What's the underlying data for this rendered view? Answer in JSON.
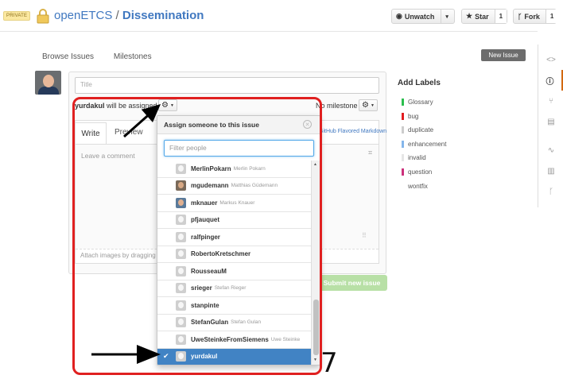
{
  "header": {
    "private_badge": "PRIVATE",
    "owner": "openETCS",
    "separator": "/",
    "repo": "Dissemination",
    "watch": {
      "label": "Unwatch",
      "caret": "▾"
    },
    "star": {
      "label": "Star",
      "count": "1"
    },
    "fork": {
      "label": "Fork",
      "count": "1"
    }
  },
  "nav": {
    "browse_issues": "Browse Issues",
    "milestones": "Milestones",
    "new_issue": "New Issue"
  },
  "form": {
    "title_placeholder": "Title",
    "assignee_name": "yurdakul",
    "assignee_suffix": " will be assigned",
    "milestone": "No milestone",
    "tab_write": "Write",
    "tab_preview": "Preview",
    "gfm": "GitHub Flavored Markdown",
    "comment_placeholder": "Leave a comment",
    "attach": "Attach images by dragging",
    "submit": "Submit new issue"
  },
  "labels": {
    "title": "Add Labels",
    "items": [
      {
        "name": "Glossary",
        "color": "#2cbe4e"
      },
      {
        "name": "bug",
        "color": "#e11d21"
      },
      {
        "name": "duplicate",
        "color": "#cccccc"
      },
      {
        "name": "enhancement",
        "color": "#84b6eb"
      },
      {
        "name": "invalid",
        "color": "#e6e6e6"
      },
      {
        "name": "question",
        "color": "#cc317c"
      },
      {
        "name": "wontfix",
        "color": "#ffffff"
      }
    ]
  },
  "dropdown": {
    "title": "Assign someone to this issue",
    "filter_placeholder": "Filter people",
    "people": [
      {
        "login": "MerlinPokarn",
        "name": "Merlin Pokarn",
        "avatar": "default"
      },
      {
        "login": "mgudemann",
        "name": "Matthias Güdemann",
        "avatar": "photo"
      },
      {
        "login": "mknauer",
        "name": "Markus Knauer",
        "avatar": "photo2"
      },
      {
        "login": "pfjauquet",
        "name": "",
        "avatar": "default"
      },
      {
        "login": "ralfpinger",
        "name": "",
        "avatar": "default"
      },
      {
        "login": "RobertoKretschmer",
        "name": "",
        "avatar": "default"
      },
      {
        "login": "RousseauM",
        "name": "",
        "avatar": "default"
      },
      {
        "login": "srieger",
        "name": "Stefan Rieger",
        "avatar": "default"
      },
      {
        "login": "stanpinte",
        "name": "",
        "avatar": "default"
      },
      {
        "login": "StefanGulan",
        "name": "Stefan Gulan",
        "avatar": "default"
      },
      {
        "login": "UweSteinkeFromSiemens",
        "name": "Uwe Steinke",
        "avatar": "default"
      },
      {
        "login": "yurdakul",
        "name": "",
        "avatar": "default",
        "selected": true
      }
    ]
  },
  "annotation": {
    "number": "7"
  },
  "colors": {
    "link": "#4078c0",
    "selected": "#4183c4",
    "annotation": "#e02020",
    "active_tab": "#d26911"
  }
}
